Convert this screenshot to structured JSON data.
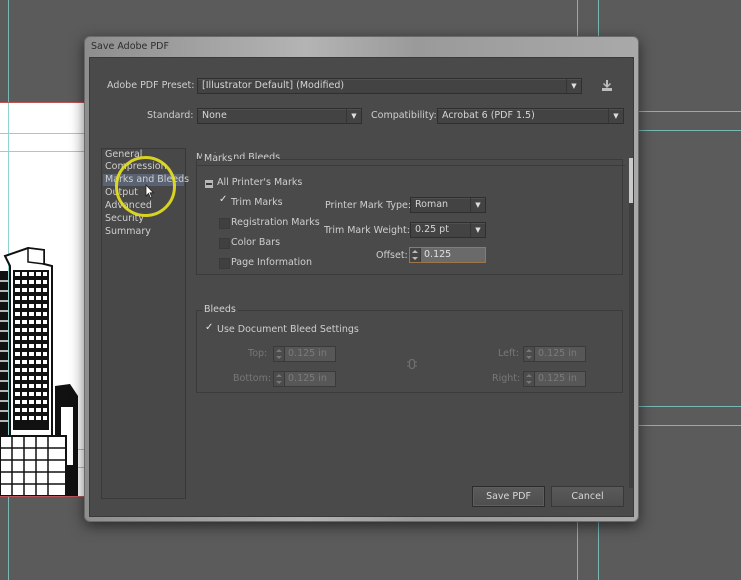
{
  "dialog": {
    "title": "Save Adobe PDF",
    "preset_label": "Adobe PDF Preset:",
    "preset_value": "[Illustrator Default] (Modified)",
    "standard_label": "Standard:",
    "standard_value": "None",
    "compatibility_label": "Compatibility:",
    "compatibility_value": "Acrobat 6 (PDF 1.5)",
    "save_preset_icon": "save-preset-icon"
  },
  "sidebar": {
    "items": [
      {
        "label": "General",
        "active": false
      },
      {
        "label": "Compression",
        "active": false
      },
      {
        "label": "Marks and Bleeds",
        "active": true
      },
      {
        "label": "Output",
        "active": false
      },
      {
        "label": "Advanced",
        "active": false
      },
      {
        "label": "Security",
        "active": false
      },
      {
        "label": "Summary",
        "active": false
      }
    ]
  },
  "panel": {
    "title": "Marks and Bleeds",
    "marks": {
      "group_title": "Marks",
      "all_printers_marks": "All Printer's Marks",
      "checkboxes": [
        {
          "label": "Trim Marks",
          "checked": true
        },
        {
          "label": "Registration Marks",
          "checked": false
        },
        {
          "label": "Color Bars",
          "checked": false
        },
        {
          "label": "Page Information",
          "checked": false
        }
      ],
      "printer_mark_type_label": "Printer Mark Type:",
      "printer_mark_type_value": "Roman",
      "trim_mark_weight_label": "Trim Mark Weight:",
      "trim_mark_weight_value": "0.25 pt",
      "offset_label": "Offset:",
      "offset_value": "0.125"
    },
    "bleeds": {
      "group_title": "Bleeds",
      "use_document_bleed_label": "Use Document Bleed Settings",
      "use_document_bleed_checked": true,
      "top_label": "Top:",
      "top_value": "0.125 in",
      "bottom_label": "Bottom:",
      "bottom_value": "0.125 in",
      "left_label": "Left:",
      "left_value": "0.125 in",
      "right_label": "Right:",
      "right_value": "0.125 in",
      "link_icon": "chain-link-icon"
    }
  },
  "buttons": {
    "save": "Save PDF",
    "cancel": "Cancel"
  },
  "glyphs": {
    "arrow": "▼",
    "check": "✓"
  },
  "colors": {
    "background": "#5b5b5b",
    "dialog_body": "#4a4a4a",
    "guide": "#7fc9c6",
    "highlight_ring": "#e8e21f",
    "selection": "#5a6373",
    "focus_border": "#a0754c"
  }
}
